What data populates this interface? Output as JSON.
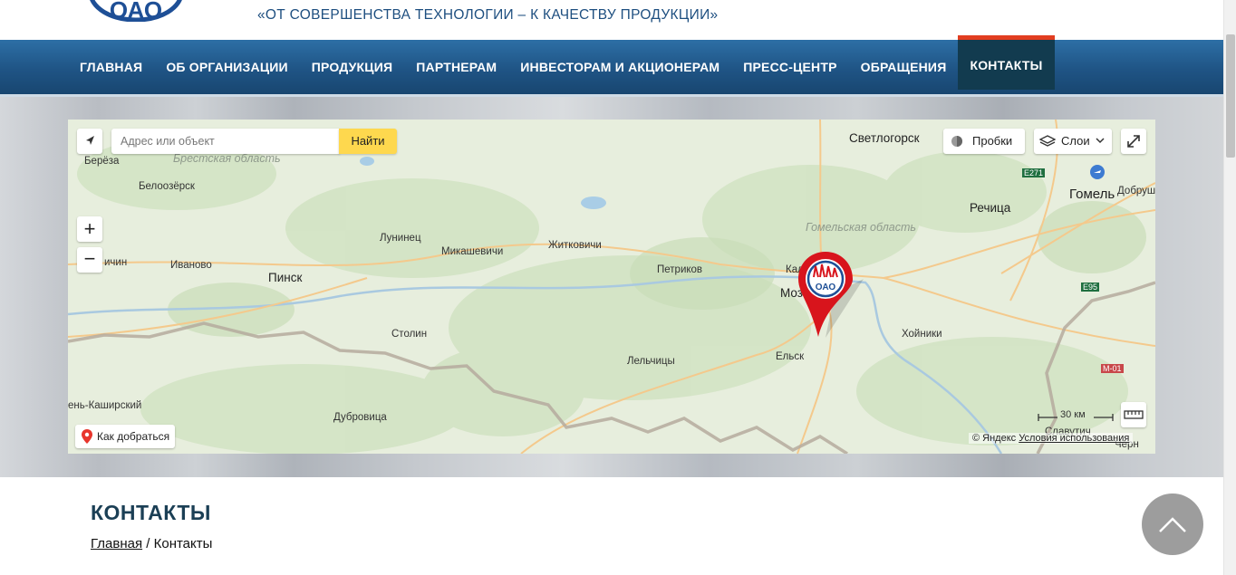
{
  "header": {
    "logo_text": "ОАО",
    "slogan": "«ОТ СОВЕРШЕНСТВА ТЕХНОЛОГИИ – К КАЧЕСТВУ ПРОДУКЦИИ»"
  },
  "nav": {
    "items": [
      {
        "label": "ГЛАВНАЯ"
      },
      {
        "label": "ОБ ОРГАНИЗАЦИИ"
      },
      {
        "label": "ПРОДУКЦИЯ"
      },
      {
        "label": "ПАРТНЕРАМ"
      },
      {
        "label": "ИНВЕСТОРАМ И АКЦИОНЕРАМ"
      },
      {
        "label": "ПРЕСС-ЦЕНТР"
      },
      {
        "label": "ОБРАЩЕНИЯ"
      },
      {
        "label": "КОНТАКТЫ",
        "active": true
      }
    ],
    "active_color": "#e23d20"
  },
  "map": {
    "search_placeholder": "Адрес или объект",
    "search_button": "Найти",
    "traffic": "Пробки",
    "layers": "Слои",
    "route": "Как добраться",
    "scale": "30 км",
    "copyright": "© Яндекс",
    "terms": "Условия использования",
    "marker_text": "ОАО",
    "regions": {
      "brest": "Брестская область",
      "gomel": "Гомельская область"
    },
    "cities": {
      "bereza": "Берёза",
      "beloozersk": "Белоозёрск",
      "svetlogorsk": "Светлогорск",
      "gomel": "Гомель",
      "dobrush": "Добруш",
      "rechitsa": "Речица",
      "luninets": "Лунинец",
      "mikashevichi": "Микашевичи",
      "zhitkovichi": "Житковичи",
      "petrikov": "Петриков",
      "kalinkovichi": "Кал",
      "mozyr": "Моз",
      "ivanovo": "Иваново",
      "drogichin": "ичин",
      "pinsk": "Пинск",
      "stolin": "Столин",
      "lelchitsy": "Лельчицы",
      "yelsk": "Ельск",
      "hoiniki": "Хойники",
      "kamen": "ень-Каширский",
      "dubrovitsa": "Дубровица",
      "slavutich": "Славутич",
      "chern": "Черн"
    },
    "roads": {
      "e271": "E271",
      "e95": "E95",
      "m01": "M-01"
    }
  },
  "content": {
    "title": "КОНТАКТЫ",
    "breadcrumb_home": "Главная",
    "breadcrumb_sep": " / ",
    "breadcrumb_current": "Контакты"
  }
}
